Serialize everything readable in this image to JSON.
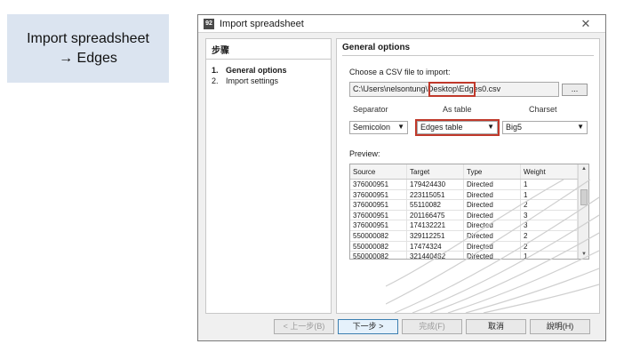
{
  "caption": {
    "line1": "Import spreadsheet",
    "line2": "→ Edges"
  },
  "window": {
    "title": "Import spreadsheet",
    "icon_text": "92",
    "close": "✕"
  },
  "steps": {
    "title": "步骤",
    "items": [
      {
        "num": "1.",
        "label": "General options"
      },
      {
        "num": "2.",
        "label": "Import settings"
      }
    ]
  },
  "general": {
    "title": "General options",
    "choose_label": "Choose a CSV file to import:",
    "file_path": "C:\\Users\\nelsontung\\Desktop\\Edges0.csv",
    "browse_label": "...",
    "separator_label": "Separator",
    "table_label": "As table",
    "charset_label": "Charset",
    "separator_value": "Semicolon",
    "table_value": "Edges table",
    "charset_value": "Big5",
    "preview_label": "Preview:"
  },
  "preview": {
    "headers": [
      "Source",
      "Target",
      "Type",
      "Weight"
    ],
    "rows": [
      [
        "376000951",
        "179424430",
        "Directed",
        "1"
      ],
      [
        "376000951",
        "223115051",
        "Directed",
        "1"
      ],
      [
        "376000951",
        "55110082",
        "Directed",
        "2"
      ],
      [
        "376000951",
        "201166475",
        "Directed",
        "3"
      ],
      [
        "376000951",
        "174132221",
        "Directed",
        "3"
      ],
      [
        "550000082",
        "329112251",
        "Directed",
        "2"
      ],
      [
        "550000082",
        "17474324",
        "Directed",
        "2"
      ],
      [
        "550000082",
        "321440482",
        "Directed",
        "1"
      ]
    ]
  },
  "footer": {
    "back": "< 上一步(B)",
    "next": "下一步 >",
    "finish": "完成(F)",
    "cancel": "取消",
    "help": "說明(H)"
  }
}
